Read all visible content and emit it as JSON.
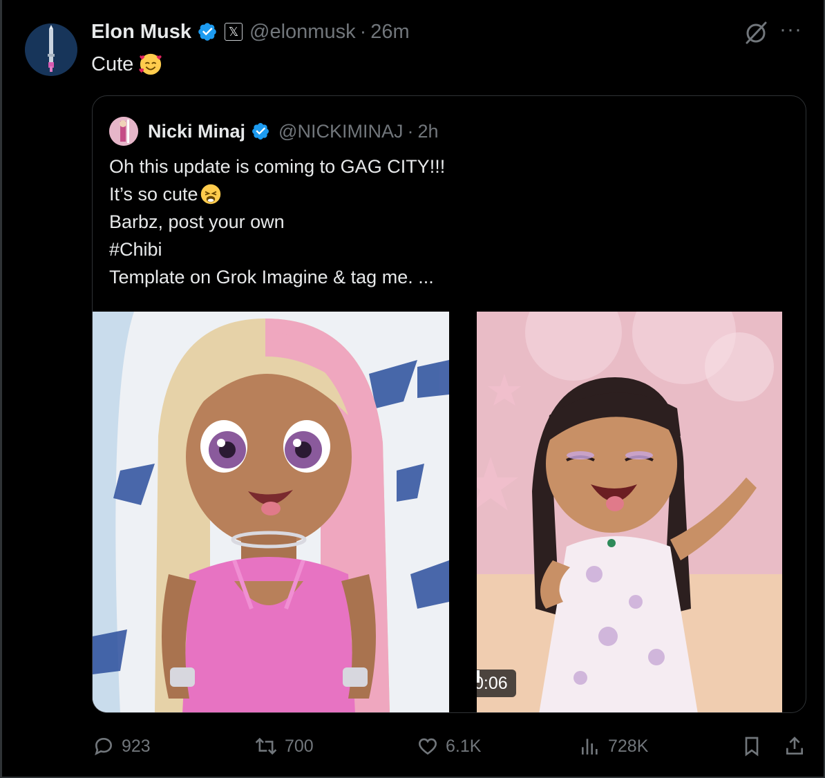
{
  "tweet": {
    "author_name": "Elon Musk",
    "handle": "@elonmusk",
    "separator": "·",
    "time": "26m",
    "x_badge_glyph": "𝕏",
    "text": "Cute",
    "emoji": "smiling-face-with-hearts",
    "more_glyph": "···"
  },
  "quote": {
    "author_name": "Nicki Minaj",
    "handle": "@NICKIMINAJ",
    "separator": "·",
    "time": "2h",
    "lines": [
      "Oh this update is coming to GAG CITY!!!",
      "It’s so cute",
      "Barbz, post your own",
      "#Chibi",
      "Template on Grok Imagine & tag me. ..."
    ],
    "video_duration": "0:06"
  },
  "actions": {
    "replies": "923",
    "reposts": "700",
    "likes": "6.1K",
    "views": "728K"
  },
  "colors": {
    "background": "#000000",
    "text_primary": "#e7e9ea",
    "text_secondary": "#71767b",
    "verified_blue": "#1d9bf0",
    "border": "#2f3336"
  }
}
